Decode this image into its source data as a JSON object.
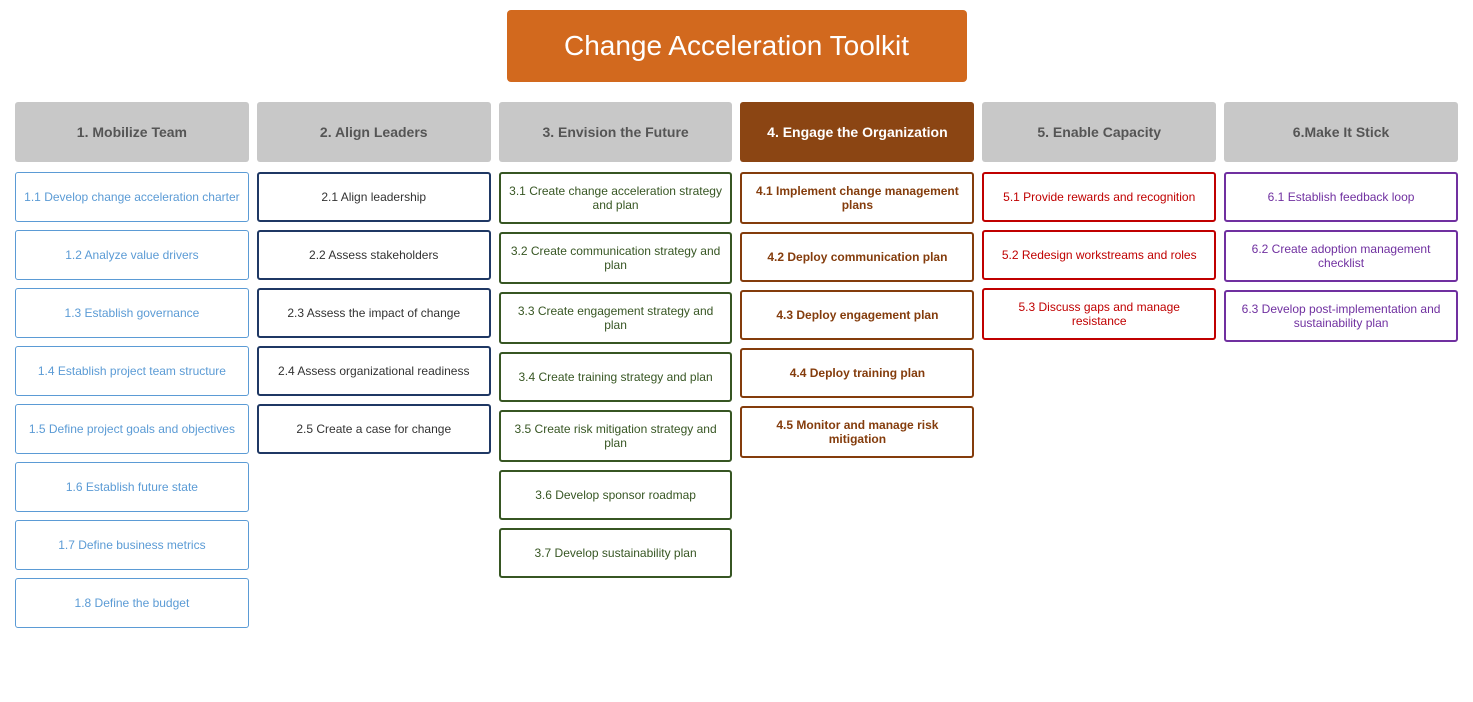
{
  "title": "Change Acceleration Toolkit",
  "columns": [
    {
      "id": "col1",
      "header": "1. Mobilize Team",
      "header_active": false,
      "cards": [
        "1.1 Develop change acceleration charter",
        "1.2 Analyze value drivers",
        "1.3 Establish governance",
        "1.4 Establish project team structure",
        "1.5 Define project goals and objectives",
        "1.6 Establish future state",
        "1.7 Define business metrics",
        "1.8 Define the budget"
      ]
    },
    {
      "id": "col2",
      "header": "2. Align Leaders",
      "header_active": false,
      "cards": [
        "2.1 Align leadership",
        "2.2 Assess stakeholders",
        "2.3 Assess the impact of change",
        "2.4 Assess organizational readiness",
        "2.5 Create a case for change"
      ]
    },
    {
      "id": "col3",
      "header": "3. Envision the Future",
      "header_active": false,
      "cards": [
        "3.1 Create change acceleration strategy and plan",
        "3.2 Create communication strategy and plan",
        "3.3 Create engagement strategy and plan",
        "3.4 Create training strategy and plan",
        "3.5 Create risk mitigation strategy and plan",
        "3.6 Develop sponsor roadmap",
        "3.7 Develop sustainability plan"
      ]
    },
    {
      "id": "col4",
      "header": "4. Engage the Organization",
      "header_active": true,
      "cards": [
        "4.1 Implement change management plans",
        "4.2 Deploy communication plan",
        "4.3 Deploy engagement plan",
        "4.4 Deploy training plan",
        "4.5 Monitor and manage risk mitigation"
      ]
    },
    {
      "id": "col5",
      "header": "5. Enable Capacity",
      "header_active": false,
      "cards": [
        "5.1 Provide rewards and recognition",
        "5.2 Redesign workstreams and roles",
        "5.3 Discuss gaps and manage resistance"
      ]
    },
    {
      "id": "col6",
      "header": "6.Make It Stick",
      "header_active": false,
      "cards": [
        "6.1 Establish feedback loop",
        "6.2 Create adoption management checklist",
        "6.3 Develop post-implementation and sustainability plan"
      ]
    }
  ]
}
